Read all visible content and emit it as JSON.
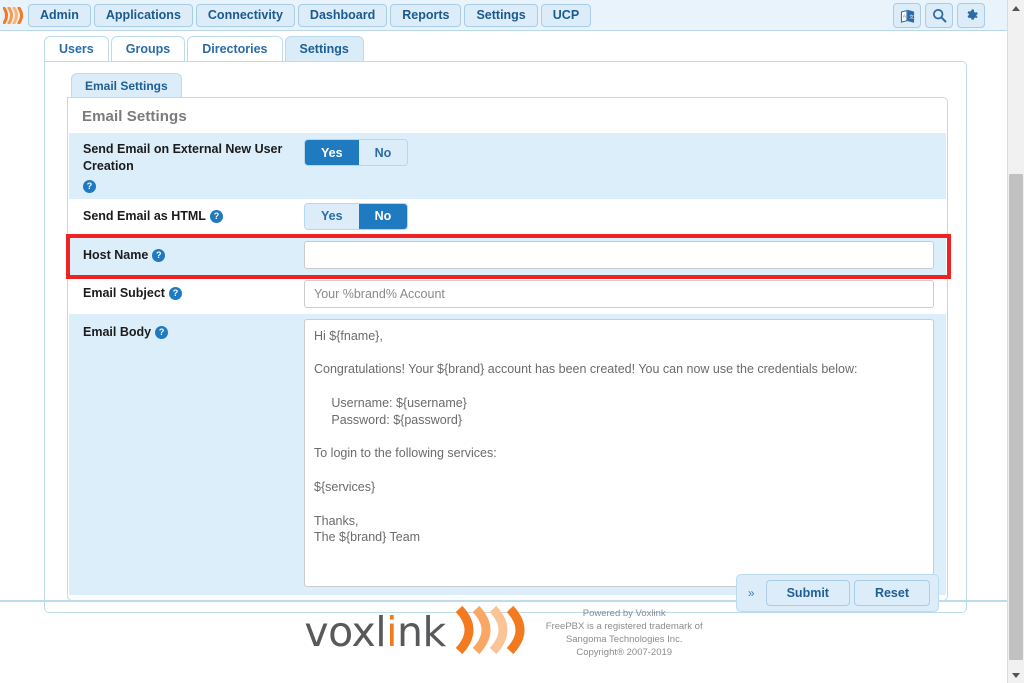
{
  "topnav": {
    "logo_icon": "voxlink-wave-logo",
    "items": [
      {
        "label": "Admin"
      },
      {
        "label": "Applications"
      },
      {
        "label": "Connectivity"
      },
      {
        "label": "Dashboard"
      },
      {
        "label": "Reports"
      },
      {
        "label": "Settings"
      },
      {
        "label": "UCP"
      }
    ],
    "right_icons": [
      {
        "name": "language-book-icon"
      },
      {
        "name": "search-icon"
      },
      {
        "name": "gear-icon"
      }
    ]
  },
  "tabs": [
    {
      "label": "Users",
      "active": false
    },
    {
      "label": "Groups",
      "active": false
    },
    {
      "label": "Directories",
      "active": false
    },
    {
      "label": "Settings",
      "active": true
    }
  ],
  "subtabs": [
    {
      "label": "Email Settings",
      "active": true
    }
  ],
  "section": {
    "title": "Email Settings"
  },
  "form": {
    "send_email_external": {
      "label": "Send Email on External New User Creation",
      "help_icon": "help-circle-icon",
      "options": [
        "Yes",
        "No"
      ],
      "selected": "Yes"
    },
    "send_email_html": {
      "label": "Send Email as HTML",
      "help_icon": "help-circle-icon",
      "options": [
        "Yes",
        "No"
      ],
      "selected": "No"
    },
    "host_name": {
      "label": "Host Name",
      "help_icon": "help-circle-icon",
      "value": "",
      "placeholder": "",
      "highlighted": true
    },
    "email_subject": {
      "label": "Email Subject",
      "help_icon": "help-circle-icon",
      "value": "Your %brand% Account",
      "placeholder": "Your %brand% Account"
    },
    "email_body": {
      "label": "Email Body",
      "help_icon": "help-circle-icon",
      "value": "Hi ${fname},\n\nCongratulations! Your ${brand} account has been created! You can now use the credentials below:\n\n     Username: ${username}\n     Password: ${password}\n\nTo login to the following services:\n\n${services}\n\nThanks,\nThe ${brand} Team"
    }
  },
  "actions": {
    "expand_label": "»",
    "submit_label": "Submit",
    "reset_label": "Reset"
  },
  "footer": {
    "logo_text_part1": "voxl",
    "logo_text_highlight": "i",
    "logo_text_part2": "nk",
    "logo_icon": "voxlink-wave-logo",
    "lines": [
      "Powered by Voxlink",
      "FreePBX is a registered trademark of",
      "Sangoma Technologies Inc.",
      "Copyright® 2007-2019"
    ]
  },
  "scrollbar": {
    "up_arrow": "scroll-up-arrow",
    "down_arrow": "scroll-down-arrow"
  },
  "colors": {
    "accent_blue": "#1f7ac0",
    "panel_border": "#bcdcee",
    "row_shade": "#dceefa",
    "highlight_red": "#ee2222",
    "brand_orange": "#f47a20"
  }
}
